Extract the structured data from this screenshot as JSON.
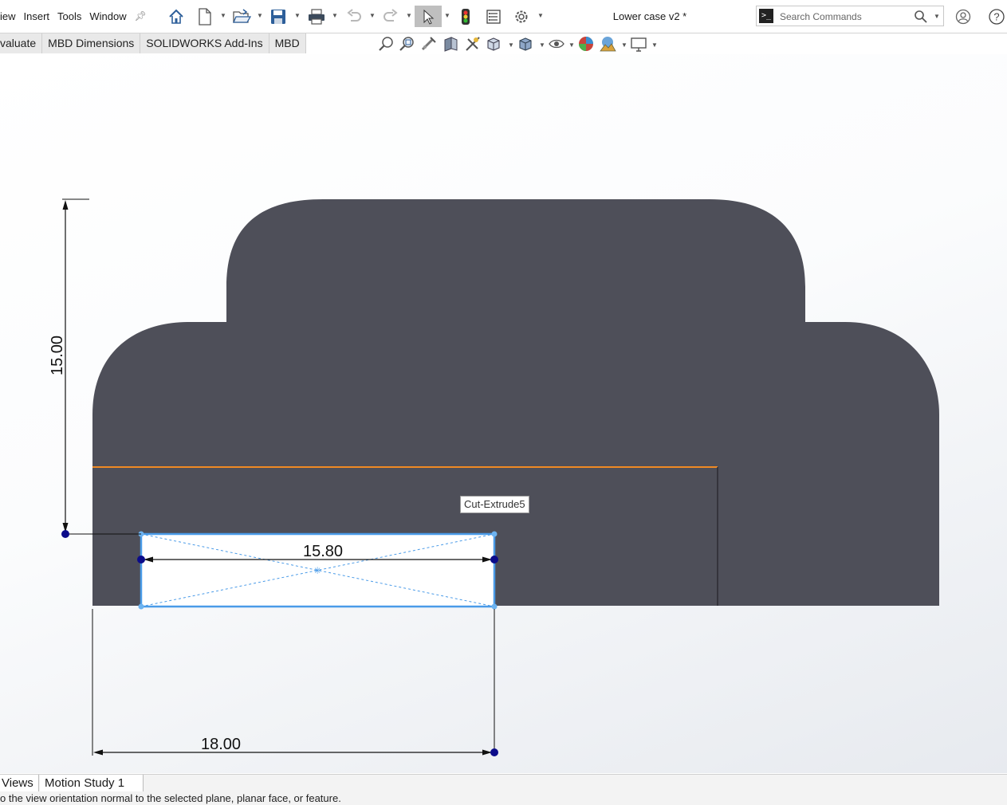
{
  "menubar": {
    "items": [
      "iew",
      "Insert",
      "Tools",
      "Window"
    ],
    "document_title": "Lower case v2 *",
    "search_placeholder": "Search Commands"
  },
  "command_tabs": [
    "valuate",
    "MBD Dimensions",
    "SOLIDWORKS Add-Ins",
    "MBD"
  ],
  "toolbar_icons": [
    "home-icon",
    "new-document-icon",
    "open-icon",
    "save-icon",
    "print-icon",
    "undo-icon",
    "redo-icon",
    "select-icon",
    "rebuild-icon",
    "file-properties-icon",
    "options-icon"
  ],
  "view_toolbar_icons": [
    "zoom-to-fit-icon",
    "zoom-to-area-icon",
    "previous-view-icon",
    "section-view-icon",
    "dynamic-annotation-icon",
    "view-orientation-icon",
    "display-style-icon",
    "hide-show-items-icon",
    "edit-appearance-icon",
    "apply-scene-icon",
    "view-settings-icon"
  ],
  "sketch": {
    "dim_vertical": "15.00",
    "dim_rect_width": "15.80",
    "dim_horizontal": "18.00",
    "feature_tooltip": "Cut-Extrude5"
  },
  "bottom_tabs": [
    "Views",
    "Motion Study 1"
  ],
  "status_text": "o the view orientation normal to the selected plane, planar face, or feature.",
  "colors": {
    "body_fill": "#4e4f59",
    "selection_blue": "#4a9be8",
    "highlight_edge": "#f08a24",
    "dimension": "#111111",
    "point": "#0b0b8a"
  }
}
